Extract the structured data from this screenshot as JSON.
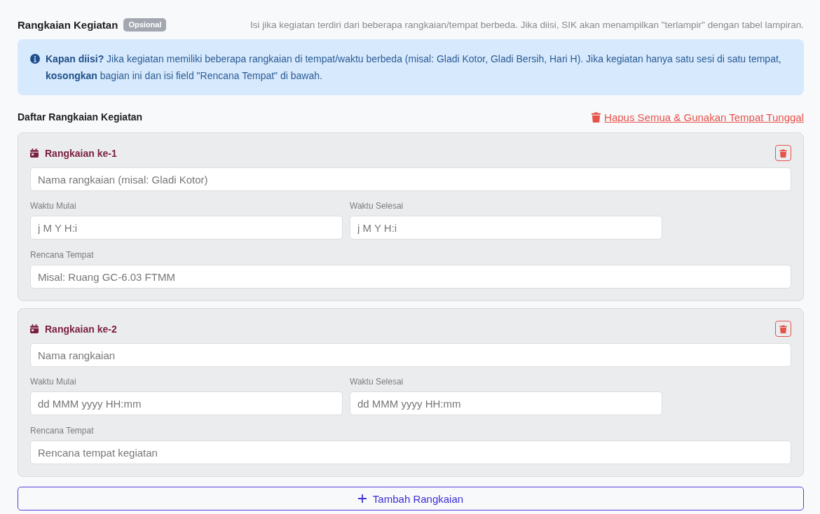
{
  "section": {
    "title": "Rangkaian Kegiatan",
    "badge": "Opsional",
    "hint": "Isi jika kegiatan terdiri dari beberapa rangkaian/tempat berbeda. Jika diisi, SIK akan menampilkan \"terlampir\" dengan tabel lampiran."
  },
  "info": {
    "text": "**Kapan diisi?** Jika kegiatan memiliki beberapa rangkaian di tempat/waktu berbeda (misal: Gladi Kotor, Gladi Bersih, Hari H). Jika kegiatan hanya satu sesi di satu tempat, **kosongkan** bagian ini dan isi field \"Rencana Tempat\" di bawah."
  },
  "list": {
    "title": "Daftar Rangkaian Kegiatan",
    "clear_link": "Hapus Semua & Gunakan Tempat Tunggal"
  },
  "rangkaian": [
    {
      "title": "Rangkaian ke-1",
      "name": {
        "placeholder": "Nama rangkaian (misal: Gladi Kotor)"
      },
      "times": [
        {
          "label": "Waktu Mulai",
          "placeholder": "j M Y H:i"
        },
        {
          "label": "Waktu Selesai",
          "placeholder": "j M Y H:i"
        }
      ],
      "place": {
        "label": "Rencana Tempat",
        "placeholder": "Misal: Ruang GC-6.03 FTMM"
      }
    },
    {
      "title": "Rangkaian ke-2",
      "name": {
        "placeholder": "Nama rangkaian"
      },
      "times": [
        {
          "label": "Waktu Mulai",
          "placeholder": "dd MMM yyyy HH:mm"
        },
        {
          "label": "Waktu Selesai",
          "placeholder": "dd MMM yyyy HH:mm"
        }
      ],
      "place": {
        "label": "Rencana Tempat",
        "placeholder": "Rencana tempat kegiatan"
      }
    }
  ],
  "add_button": "Tambah Rangkaian"
}
